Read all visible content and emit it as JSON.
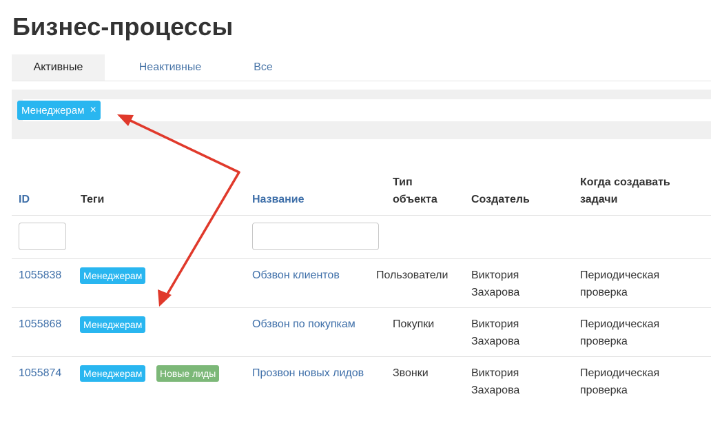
{
  "page": {
    "title": "Бизнес-процессы"
  },
  "tabs": [
    {
      "label": "Активные",
      "active": true
    },
    {
      "label": "Неактивные",
      "active": false
    },
    {
      "label": "Все",
      "active": false
    }
  ],
  "filter": {
    "chip_label": "Менеджерам",
    "chip_close": "×",
    "chip_color": "#29b6f0"
  },
  "table": {
    "columns": {
      "id": "ID",
      "tags": "Теги",
      "name": "Название",
      "object_type_line1": "Тип",
      "object_type_line2": "объекта",
      "creator": "Создатель",
      "when_line1": "Когда создавать",
      "when_line2": "задачи"
    },
    "rows": [
      {
        "id": "1055838",
        "tags": [
          "Менеджерам"
        ],
        "name": "Обзвон клиентов",
        "object_type": "Пользователи",
        "creator_line1": "Виктория",
        "creator_line2": "Захарова",
        "when_line1": "Периодическая",
        "when_line2": "проверка"
      },
      {
        "id": "1055868",
        "tags": [
          "Менеджерам"
        ],
        "name": "Обзвон по покупкам",
        "object_type": "Покупки",
        "creator_line1": "Виктория",
        "creator_line2": "Захарова",
        "when_line1": "Периодическая",
        "when_line2": "проверка"
      },
      {
        "id": "1055874",
        "tags": [
          "Менеджерам",
          "Новые лиды"
        ],
        "name": "Прозвон новых лидов",
        "object_type": "Звонки",
        "creator_line1": "Виктория",
        "creator_line2": "Захарова",
        "when_line1": "Периодическая",
        "when_line2": "проверка"
      }
    ]
  },
  "colors": {
    "tag_blue": "#29b6f0",
    "tag_green": "#7cb878",
    "link": "#3d6ea8",
    "annotation_arrow": "#e0392b"
  }
}
